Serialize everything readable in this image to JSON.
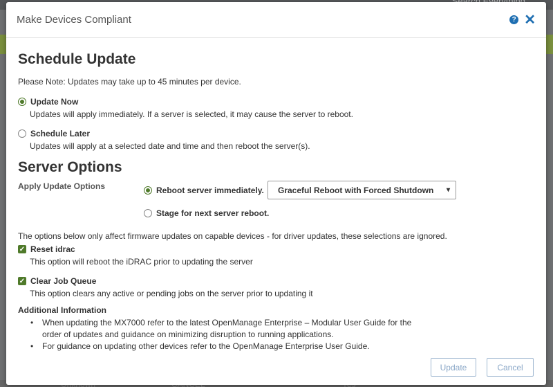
{
  "background": {
    "search_text": "Search Everything",
    "bottom_texts": [
      "Unknown",
      "CANCEL",
      "Yes"
    ]
  },
  "modal": {
    "title": "Make Devices Compliant",
    "help_icon": "question-circle-icon",
    "close_icon": "close-icon"
  },
  "schedule": {
    "heading": "Schedule Update",
    "note": "Please Note: Updates may take up to 45 minutes per device.",
    "update_now": {
      "label": "Update Now",
      "desc": "Updates will apply immediately. If a server is selected, it may cause the server to reboot.",
      "selected": true
    },
    "schedule_later": {
      "label": "Schedule Later",
      "desc": "Updates will apply at a selected date and time and then reboot the server(s).",
      "selected": false
    }
  },
  "server_options": {
    "heading": "Server Options",
    "apply_label": "Apply Update Options",
    "reboot_now": {
      "label": "Reboot server immediately.",
      "selected": true
    },
    "reboot_type": "Graceful Reboot with Forced Shutdown",
    "stage": {
      "label": "Stage for next server reboot.",
      "selected": false
    }
  },
  "firmware": {
    "note": "The options below only affect firmware updates on capable devices - for driver updates, these selections are ignored.",
    "reset_idrac": {
      "label": "Reset idrac",
      "desc": "This option will reboot the iDRAC prior to updating the server",
      "checked": true
    },
    "clear_queue": {
      "label": "Clear Job Queue",
      "desc": "This option clears any active or pending jobs on the server prior to updating it",
      "checked": true
    }
  },
  "additional": {
    "heading": "Additional Information",
    "items": [
      "When updating the MX7000 refer to the latest OpenManage Enterprise – Modular User Guide for the order of updates and guidance on minimizing disruption to running applications.",
      "For guidance on updating other devices refer to the OpenManage Enterprise User Guide."
    ]
  },
  "footer": {
    "update_label": "Update",
    "cancel_label": "Cancel"
  },
  "colors": {
    "accent": "#4f7a2a",
    "link": "#1f6fb2"
  }
}
